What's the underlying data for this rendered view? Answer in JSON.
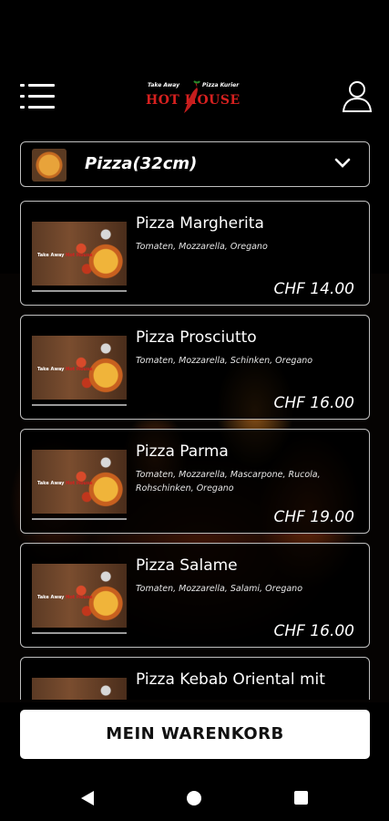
{
  "header": {
    "logo_small_left": "Take Away",
    "logo_small_right": "Pizza Kurier",
    "logo_text": "HOT HOUSE"
  },
  "category": {
    "selected": "Pizza(32cm)"
  },
  "products": [
    {
      "title": "Pizza Margherita",
      "desc": "Tomaten, Mozzarella, Oregano",
      "price": "CHF 14.00"
    },
    {
      "title": "Pizza Prosciutto",
      "desc": "Tomaten, Mozzarella, Schinken, Oregano",
      "price": "CHF 16.00"
    },
    {
      "title": "Pizza Parma",
      "desc": "Tomaten, Mozzarella, Mascarpone, Rucola, Rohschinken, Oregano",
      "price": "CHF 19.00"
    },
    {
      "title": "Pizza Salame",
      "desc": "Tomaten, Mozzarella, Salami, Oregano",
      "price": "CHF 16.00"
    },
    {
      "title": "Pizza Kebab Oriental mit",
      "desc": "",
      "price": ""
    }
  ],
  "cart": {
    "label": "MEIN WARENKORB"
  },
  "colors": {
    "accent_red": "#d6201f",
    "card_border": "#bfbfbf"
  },
  "icons": [
    "menu-icon",
    "user-icon",
    "chevron-down-icon",
    "back-icon",
    "home-icon",
    "recent-apps-icon"
  ]
}
